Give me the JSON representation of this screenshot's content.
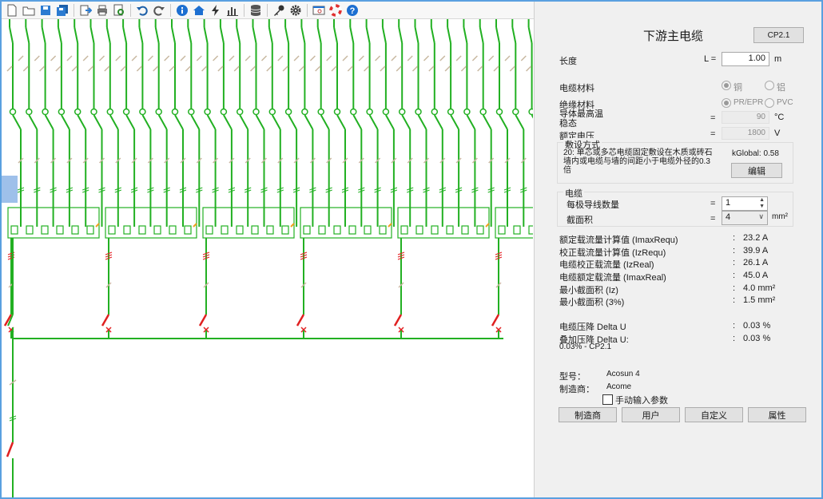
{
  "panel": {
    "title": "下游主电缆",
    "cp_button": "CP2.1",
    "length": {
      "label": "长度",
      "symbol": "L =",
      "value": "1.00",
      "unit": "m"
    },
    "material": {
      "label": "电缆材料",
      "opt1": "铜",
      "opt2": "铝"
    },
    "insulation": {
      "label": "绝缘材料",
      "opt1": "PR/EPR",
      "opt2": "PVC"
    },
    "max_temp": {
      "label_line1": "导体最高温",
      "label_line2": "稳态",
      "eq": "=",
      "value": "90",
      "unit": "°C"
    },
    "rated_voltage": {
      "label": "额定电压",
      "eq": "=",
      "value": "1800",
      "unit": "V"
    },
    "install": {
      "group_title": "敷设方式",
      "desc_line1": "20: 单芯或多芯电缆固定敷设在木质或砖石",
      "desc_line2": "墙内或电缆与墙的间距小于电缆外径的0.3",
      "desc_line3": "倍",
      "kglobal": "kGlobal: 0.58",
      "edit_button": "编辑"
    },
    "cable": {
      "group_title": "电缆",
      "conductors_label": "每极导线数量",
      "conductors_eq": "=",
      "conductors_value": "1",
      "section_label": "截面积",
      "section_eq": "=",
      "section_value": "4",
      "section_unit": "mm²"
    },
    "results": [
      {
        "label": "额定载流量计算值 (ImaxRequ)",
        "sep": ":",
        "value": "23.2 A"
      },
      {
        "label": "校正载流量计算值 (IzRequ)",
        "sep": ":",
        "value": "39.9 A"
      },
      {
        "label": "电缆校正载流量 (IzReal)",
        "sep": ":",
        "value": "26.1 A"
      },
      {
        "label": "电缆额定载流量 (ImaxReal)",
        "sep": ":",
        "value": "45.0 A"
      },
      {
        "label": "最小截面积 (Iz)",
        "sep": ":",
        "value": "4.0 mm²"
      },
      {
        "label": "最小截面积 (3%)",
        "sep": ":",
        "value": "1.5 mm²"
      }
    ],
    "drop": {
      "label": "电缆压降 Delta U",
      "sep": ":",
      "value": "0.03 %"
    },
    "stack": {
      "label": "叠加压降 Delta U:",
      "sep": ":",
      "value": "0.03 %",
      "sub": "0.03% - CP2.1"
    },
    "model": {
      "label": "型号：",
      "value": "Acosun 4"
    },
    "maker": {
      "label": "制造商：",
      "value": "Acome"
    },
    "manual_checkbox": "手动输入参数",
    "buttons": [
      "制造商",
      "用户",
      "自定义",
      "属性"
    ]
  },
  "toolbar": {
    "icons": [
      "new-file-icon",
      "open-folder-icon",
      "save-icon",
      "save-all-icon",
      "export-icon",
      "print-icon",
      "print-preview-icon",
      "undo-icon",
      "redo-icon",
      "info-icon",
      "home-icon",
      "lightning-icon",
      "bar-chart-icon",
      "database-icon",
      "key-icon",
      "gear-icon",
      "search-window-icon",
      "help-ring-icon",
      "help-icon"
    ]
  },
  "colors": {
    "wire": "#22b022",
    "breaker": "#e02020",
    "tick": "#c8b8a0",
    "selection": "#9ec0ea",
    "frame": "#5aa0e0"
  }
}
